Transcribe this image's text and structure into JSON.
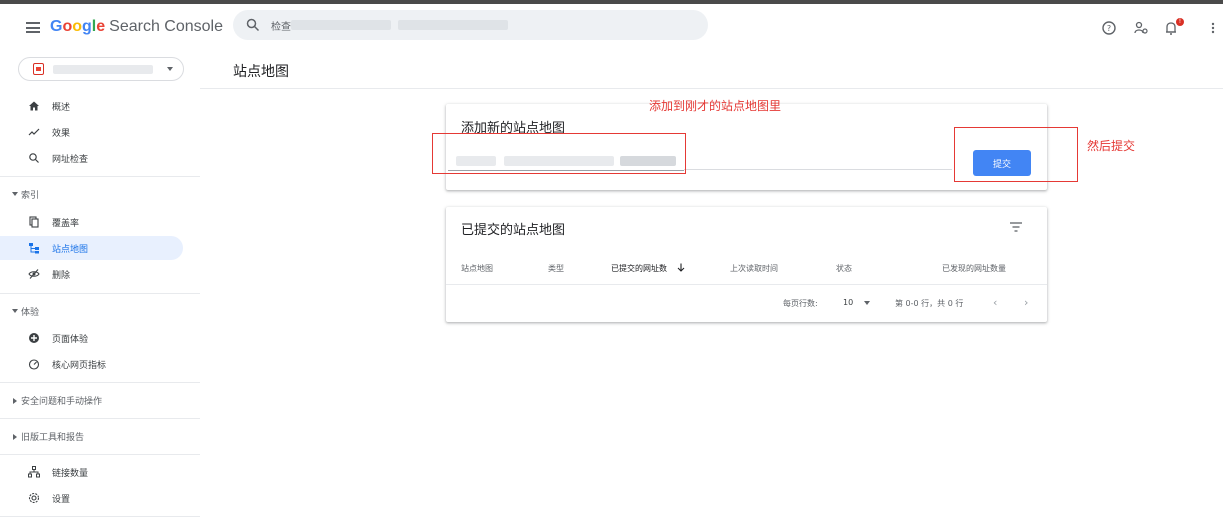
{
  "header": {
    "logo_google": "Google",
    "logo_product": "Search Console",
    "search_placeholder": "检查"
  },
  "property": {
    "selector_icon": "site-favicon"
  },
  "page_title": "站点地图",
  "sidebar": {
    "items": [
      {
        "label": "概述",
        "icon": "home-icon"
      },
      {
        "label": "效果",
        "icon": "trending-icon"
      },
      {
        "label": "网址检查",
        "icon": "search-icon"
      }
    ],
    "sections": {
      "index": "索引",
      "experience": "体验",
      "security": "安全问题和手动操作",
      "legacy": "旧版工具和报告"
    },
    "index_items": [
      {
        "label": "覆盖率",
        "icon": "copy-icon"
      },
      {
        "label": "站点地图",
        "icon": "sitemap-icon",
        "active": true
      },
      {
        "label": "删除",
        "icon": "visibility-off-icon"
      }
    ],
    "experience_items": [
      {
        "label": "页面体验",
        "icon": "page-experience-icon"
      },
      {
        "label": "核心网页指标",
        "icon": "speed-icon"
      }
    ],
    "bottom_items": [
      {
        "label": "链接数量",
        "icon": "links-icon"
      },
      {
        "label": "设置",
        "icon": "gear-icon"
      }
    ]
  },
  "add_sitemap": {
    "title": "添加新的站点地图",
    "submit_label": "提交"
  },
  "submitted": {
    "title": "已提交的站点地图",
    "columns": [
      "站点地图",
      "类型",
      "已提交的网址数",
      "上次读取时间",
      "状态",
      "已发现的网址数量"
    ],
    "rows_per_page_label": "每页行数:",
    "rows_per_page_value": "10",
    "range_label": "第 0-0 行，共 0 行"
  },
  "annotations": {
    "add_note": "添加到刚才的站点地图里",
    "submit_note": "然后提交"
  },
  "colors": {
    "accent": "#4285f4",
    "active_nav": "#e8f0fe",
    "annotation": "#e53935"
  }
}
